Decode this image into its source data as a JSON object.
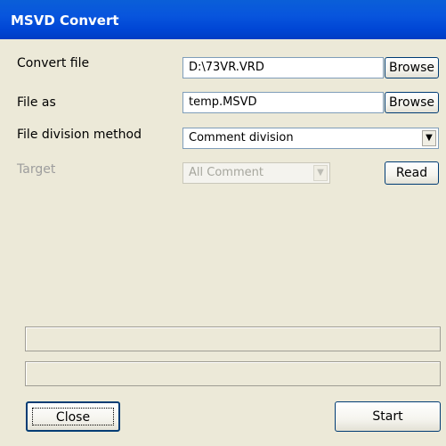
{
  "window": {
    "title": "MSVD Convert"
  },
  "convert_file": {
    "label": "Convert file",
    "value": "D:\\73VR.VRD",
    "browse_label": "Browse"
  },
  "file_as": {
    "label": "File as",
    "value": "temp.MSVD",
    "browse_label": "Browse"
  },
  "division": {
    "label": "File division method",
    "selected": "Comment division"
  },
  "target": {
    "label": "Target",
    "selected": "All Comment",
    "read_label": "Read"
  },
  "progress": {
    "bar1": 0,
    "bar2": 0
  },
  "buttons": {
    "close_label": "Close",
    "start_label": "Start"
  }
}
